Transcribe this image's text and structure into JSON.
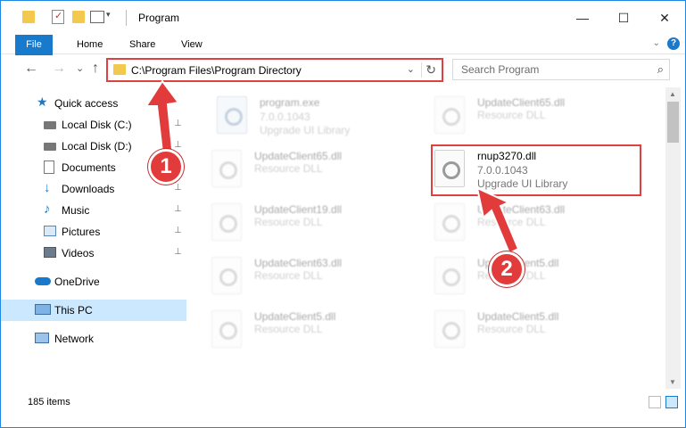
{
  "window": {
    "title": "Program",
    "minimize": "—",
    "maximize": "☐",
    "close": "✕"
  },
  "ribbon": {
    "tabs": [
      "File",
      "Home",
      "Share",
      "View"
    ],
    "expand": "⌄",
    "help": "?"
  },
  "nav": {
    "back": "←",
    "forward": "→",
    "history": "⌄",
    "up": "↑",
    "address": "C:\\Program Files\\Program Directory",
    "address_dropdown": "⌄",
    "refresh": "↻",
    "search_placeholder": "Search Program",
    "search_icon": "⌕"
  },
  "sidebar": {
    "items": [
      {
        "label": "Quick access",
        "icon": "star-icon",
        "pinned": false
      },
      {
        "label": "Local Disk (C:)",
        "icon": "drive-icon",
        "pinned": true
      },
      {
        "label": "Local Disk (D:)",
        "icon": "drive-icon",
        "pinned": true
      },
      {
        "label": "Documents",
        "icon": "documents-icon",
        "pinned": true
      },
      {
        "label": "Downloads",
        "icon": "download-icon",
        "pinned": true
      },
      {
        "label": "Music",
        "icon": "music-icon",
        "pinned": true
      },
      {
        "label": "Pictures",
        "icon": "pictures-icon",
        "pinned": true
      },
      {
        "label": "Videos",
        "icon": "videos-icon",
        "pinned": true
      },
      {
        "label": "OneDrive",
        "icon": "cloud-icon",
        "pinned": false
      },
      {
        "label": "This PC",
        "icon": "computer-icon",
        "pinned": false,
        "selected": true
      },
      {
        "label": "Network",
        "icon": "network-icon",
        "pinned": false
      }
    ],
    "pin_glyph": "📌"
  },
  "files": [
    {
      "name": "program.exe",
      "version": "7.0.0.1043",
      "desc": "Upgrade UI Library",
      "type": "exe"
    },
    {
      "name": "UpdateClient65.dll",
      "version": "",
      "desc": "Resource DLL",
      "type": "dll"
    },
    {
      "name": "UpdateClient65.dll",
      "version": "",
      "desc": "Resource DLL",
      "type": "dll"
    },
    {
      "name": "rnup3270.dll",
      "version": "7.0.0.1043",
      "desc": "Upgrade UI Library",
      "type": "dll",
      "highlighted": true
    },
    {
      "name": "UpdateClient19.dll",
      "version": "",
      "desc": "Resource DLL",
      "type": "dll"
    },
    {
      "name": "UpdateClient63.dll",
      "version": "",
      "desc": "Resource DLL",
      "type": "dll"
    },
    {
      "name": "UpdateClient63.dll",
      "version": "",
      "desc": "Resource DLL",
      "type": "dll"
    },
    {
      "name": "UpdateClient5.dll",
      "version": "",
      "desc": "Resource DLL",
      "type": "dll"
    },
    {
      "name": "UpdateClient5.dll",
      "version": "",
      "desc": "Resource DLL",
      "type": "dll"
    },
    {
      "name": "UpdateClient5.dll",
      "version": "",
      "desc": "Resource DLL",
      "type": "dll"
    }
  ],
  "status": {
    "count": "185 items"
  },
  "annotations": {
    "step1": "1",
    "step2": "2",
    "color": "#e04040"
  }
}
